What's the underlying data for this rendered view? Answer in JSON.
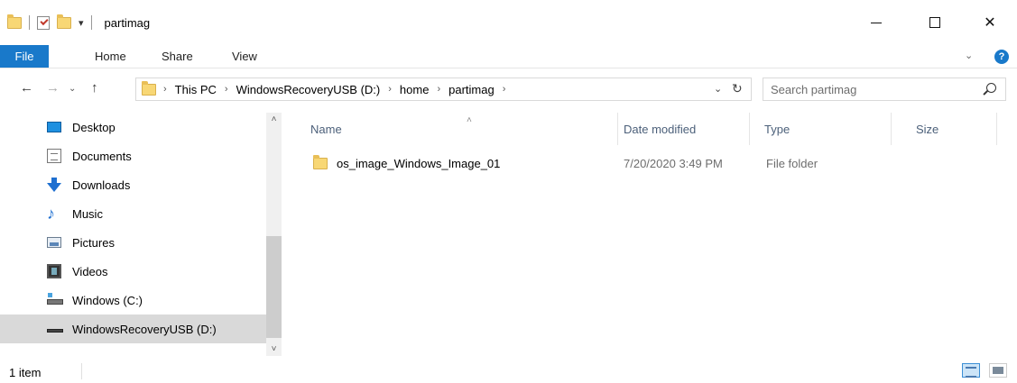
{
  "window": {
    "title": "partimag",
    "qa_dropdown": "▾",
    "minimize": "—",
    "maximize": "☐",
    "close": "✕"
  },
  "ribbon": {
    "tabs": [
      "File",
      "Home",
      "Share",
      "View"
    ],
    "collapse": "⌄",
    "help": "?"
  },
  "nav": {
    "back": "←",
    "forward": "→",
    "recent": "⌄",
    "up": "↑"
  },
  "address": {
    "crumbs": [
      "This PC",
      "WindowsRecoveryUSB (D:)",
      "home",
      "partimag"
    ],
    "sep": "›",
    "dropdown": "⌄",
    "refresh": "↻"
  },
  "search": {
    "placeholder": "Search partimag"
  },
  "navpane": {
    "items": [
      {
        "label": "Desktop",
        "icon": "desktop-icon"
      },
      {
        "label": "Documents",
        "icon": "documents-icon"
      },
      {
        "label": "Downloads",
        "icon": "downloads-icon"
      },
      {
        "label": "Music",
        "icon": "music-icon"
      },
      {
        "label": "Pictures",
        "icon": "pictures-icon"
      },
      {
        "label": "Videos",
        "icon": "videos-icon"
      },
      {
        "label": "Windows (C:)",
        "icon": "drive-c-icon"
      },
      {
        "label": "WindowsRecoveryUSB (D:)",
        "icon": "usb-drive-icon",
        "selected": true
      }
    ],
    "scroll_up": "˄",
    "scroll_down": "˅"
  },
  "filelist": {
    "columns": [
      "Name",
      "Date modified",
      "Type",
      "Size"
    ],
    "sort_indicator": "˄",
    "rows": [
      {
        "name": "os_image_Windows_Image_01",
        "date": "7/20/2020 3:49 PM",
        "type": "File folder",
        "size": ""
      }
    ]
  },
  "status": {
    "text": "1 item"
  },
  "colors": {
    "accent": "#1979ca",
    "selection": "#d9d9d9"
  }
}
